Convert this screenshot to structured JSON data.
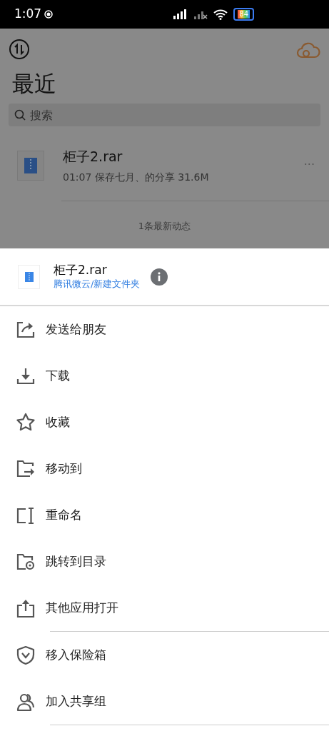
{
  "status_bar": {
    "time": "1:07",
    "battery": "84"
  },
  "header": {
    "title": "最近"
  },
  "search": {
    "placeholder": "搜索"
  },
  "files": [
    {
      "name": "柜子2.rar",
      "meta": "01:07  保存七月、的分享  31.6M",
      "more": "···"
    }
  ],
  "feed_note": "1条最新动态",
  "sheet": {
    "file_name": "柜子2.rar",
    "path": "腾讯微云/新建文件夹",
    "actions": [
      {
        "label": "发送给朋友",
        "divider_after": false
      },
      {
        "label": "下载",
        "divider_after": false
      },
      {
        "label": "收藏",
        "divider_after": false
      },
      {
        "label": "移动到",
        "divider_after": false
      },
      {
        "label": "重命名",
        "divider_after": false
      },
      {
        "label": "跳转到目录",
        "divider_after": false
      },
      {
        "label": "其他应用打开",
        "divider_after": true
      },
      {
        "label": "移入保险箱",
        "divider_after": false
      },
      {
        "label": "加入共享组",
        "divider_after": true
      }
    ]
  }
}
